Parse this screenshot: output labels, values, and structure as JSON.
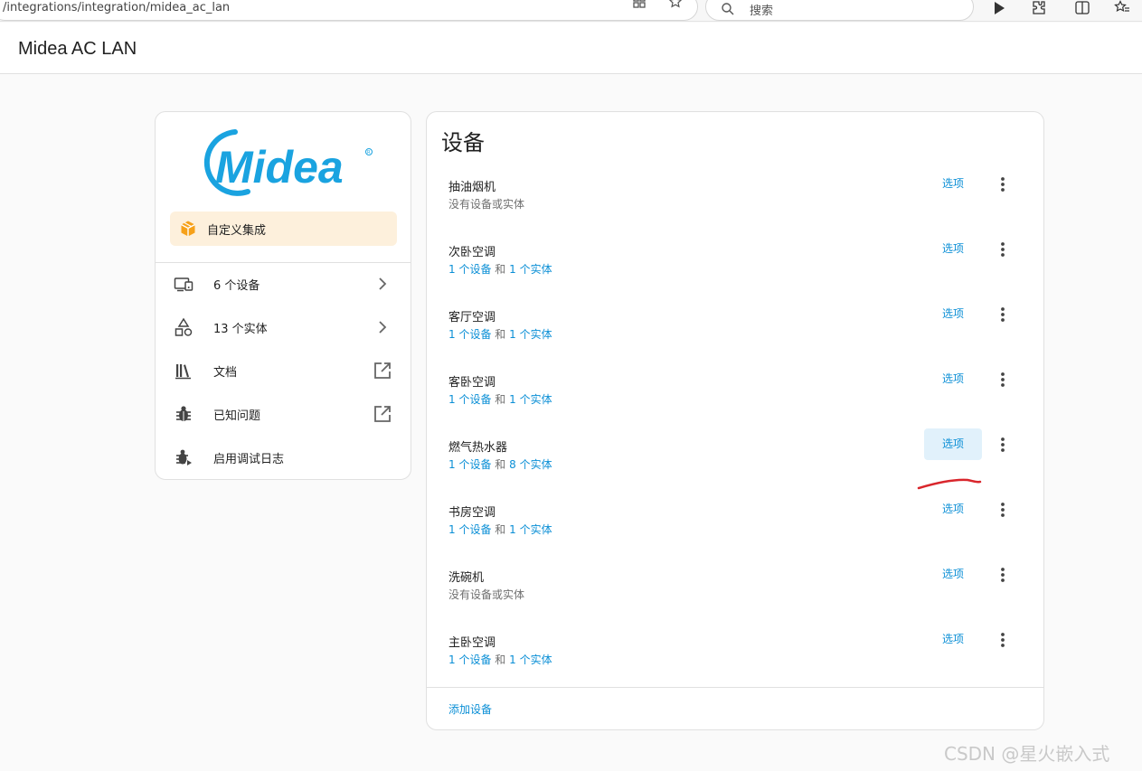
{
  "browser": {
    "url": "/integrations/integration/midea_ac_lan",
    "search_placeholder": "搜索",
    "icons": [
      "grid-icon",
      "star-icon",
      "search-icon",
      "play-icon",
      "extension-icon",
      "split-icon",
      "favorites-icon"
    ]
  },
  "header": {
    "title": "Midea AC LAN"
  },
  "sidebar": {
    "logo_text": "Midea",
    "custom_label": "自定义集成",
    "items": [
      {
        "label": "6 个设备",
        "icon": "devices-icon",
        "trail": "chevron-right-icon"
      },
      {
        "label": "13 个实体",
        "icon": "shapes-icon",
        "trail": "chevron-right-icon"
      },
      {
        "label": "文档",
        "icon": "library-icon",
        "trail": "open-in-new-icon"
      },
      {
        "label": "已知问题",
        "icon": "bug-icon",
        "trail": "open-in-new-icon"
      },
      {
        "label": "启用调试日志",
        "icon": "bug-play-icon",
        "trail": ""
      }
    ]
  },
  "devices_section": {
    "title": "设备",
    "option_label": "选项",
    "add_label": "添加设备",
    "devices": [
      {
        "name": "抽油烟机",
        "empty_text": "没有设备或实体"
      },
      {
        "name": "次卧空调",
        "devices_text": "1 个设备",
        "joiner": "和",
        "entities_text": "1 个实体"
      },
      {
        "name": "客厅空调",
        "devices_text": "1 个设备",
        "joiner": "和",
        "entities_text": "1 个实体"
      },
      {
        "name": "客卧空调",
        "devices_text": "1 个设备",
        "joiner": "和",
        "entities_text": "1 个实体"
      },
      {
        "name": "燃气热水器",
        "devices_text": "1 个设备",
        "joiner": "和",
        "entities_text": "8 个实体",
        "highlighted": true
      },
      {
        "name": "书房空调",
        "devices_text": "1 个设备",
        "joiner": "和",
        "entities_text": "1 个实体"
      },
      {
        "name": "洗碗机",
        "empty_text": "没有设备或实体"
      },
      {
        "name": "主卧空调",
        "devices_text": "1 个设备",
        "joiner": "和",
        "entities_text": "1 个实体"
      }
    ]
  },
  "watermark": "CSDN @星火嵌入式",
  "colors": {
    "accent": "#0b8fd6",
    "brand_blue": "#1aa3e0",
    "badge_bg": "#fdf0dc",
    "badge_icon": "#f6a11a",
    "highlight_bg": "#e1f1fb",
    "annotation": "#d9262c"
  }
}
